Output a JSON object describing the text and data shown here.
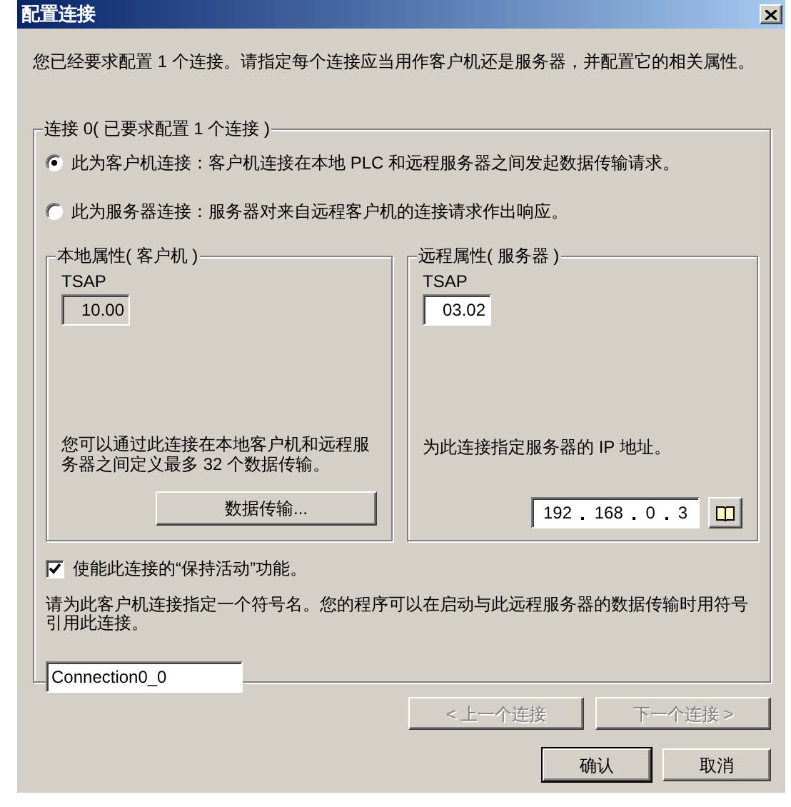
{
  "window": {
    "title": "配置连接"
  },
  "intro": "您已经要求配置 1 个连接。请指定每个连接应当用作客户机还是服务器，并配置它的相关属性。",
  "connection": {
    "title": "连接 0( 已要求配置 1 个连接 )",
    "options": [
      {
        "label": "此为客户机连接：客户机连接在本地 PLC 和远程服务器之间发起数据传输请求。",
        "selected": true
      },
      {
        "label": "此为服务器连接：服务器对来自远程客户机的连接请求作出响应。",
        "selected": false
      }
    ],
    "local": {
      "title": "本地属性( 客户机 )",
      "tsap_label": "TSAP",
      "tsap_value": "10.00",
      "tsap_disabled": true,
      "description": "您可以通过此连接在本地客户机和远程服务器之间定义最多 32 个数据传输。",
      "button": "数据传输..."
    },
    "remote": {
      "title": "远程属性( 服务器 )",
      "tsap_label": "TSAP",
      "tsap_value": "03.02",
      "tsap_disabled": false,
      "description": "为此连接指定服务器的 IP 地址。",
      "ip": [
        "192",
        "168",
        "0",
        "3"
      ]
    },
    "keep_alive": {
      "label": "使能此连接的“保持活动”功能。",
      "checked": true
    },
    "symbol_help": "请为此客户机连接指定一个符号名。您的程序可以在启动与此远程服务器的数据传输时用符号引用此连接。",
    "symbol_name": "Connection0_0"
  },
  "nav_buttons": [
    {
      "label": "< 上一个连接",
      "disabled": true
    },
    {
      "label": "下一个连接 >",
      "disabled": true
    }
  ],
  "buttons": [
    {
      "label": "确认",
      "default": true
    },
    {
      "label": "取消",
      "default": false
    }
  ]
}
